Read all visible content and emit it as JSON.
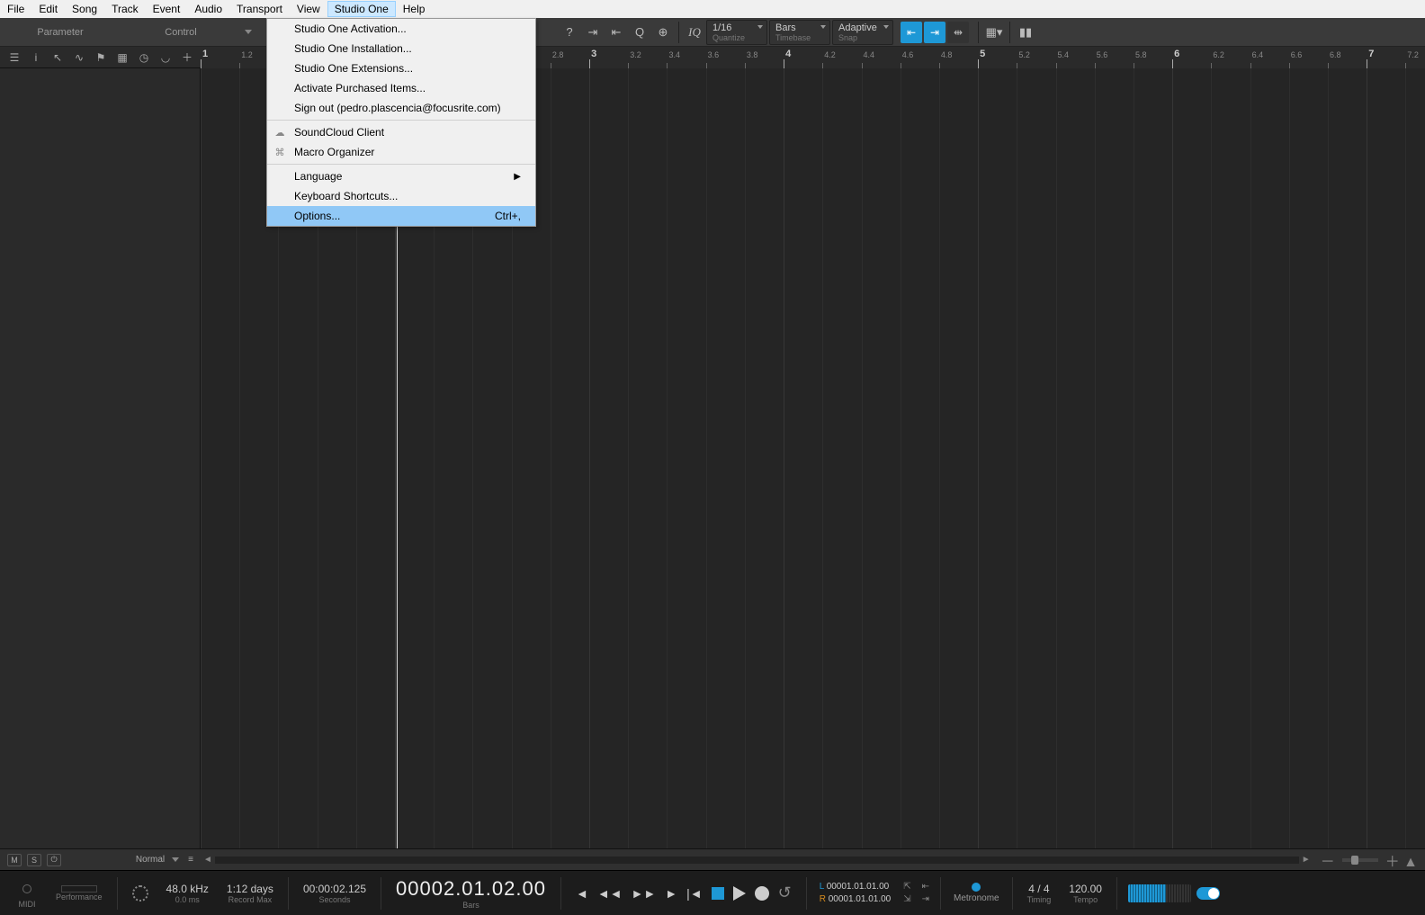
{
  "menubar": [
    "File",
    "Edit",
    "Song",
    "Track",
    "Event",
    "Audio",
    "Transport",
    "View",
    "Studio One",
    "Help"
  ],
  "menubar_active_index": 8,
  "dropdown": {
    "groups": [
      [
        {
          "label": "Studio One Activation..."
        },
        {
          "label": "Studio One Installation..."
        },
        {
          "label": "Studio One Extensions..."
        },
        {
          "label": "Activate Purchased Items..."
        },
        {
          "label": "Sign out (pedro.plascencia@focusrite.com)"
        }
      ],
      [
        {
          "label": "SoundCloud Client",
          "icon": "cloud"
        },
        {
          "label": "Macro Organizer",
          "icon": "macro"
        }
      ],
      [
        {
          "label": "Language",
          "submenu": true
        },
        {
          "label": "Keyboard Shortcuts..."
        },
        {
          "label": "Options...",
          "shortcut": "Ctrl+,",
          "highlight": true
        }
      ]
    ]
  },
  "parameter_label": "Parameter",
  "control_label": "Control",
  "iq_label": "IQ",
  "quantize": {
    "value": "1/16",
    "label": "Quantize"
  },
  "timebase": {
    "value": "Bars",
    "label": "Timebase"
  },
  "snap": {
    "value": "Adaptive",
    "label": "Snap"
  },
  "timesig": {
    "num": "4",
    "den": "4/4"
  },
  "ruler_start": 1,
  "ruler_end": 7.3,
  "playhead_bar": 2.01,
  "track_controls": {
    "m": "M",
    "s": "S",
    "mode": "Normal"
  },
  "transport": {
    "midi": "MIDI",
    "performance": "Performance",
    "sample_rate": "48.0 kHz",
    "latency": "0.0 ms",
    "rec_max": "1:12 days",
    "rec_max_label": "Record Max",
    "seconds": "00:00:02.125",
    "seconds_label": "Seconds",
    "bars": "00002.01.02.00",
    "bars_label": "Bars",
    "loc_l": "00001.01.01.00",
    "loc_r": "00001.01.01.00",
    "l_prefix": "L",
    "r_prefix": "R",
    "metronome": "Metronome",
    "timing_sig": "4 / 4",
    "timing_label": "Timing",
    "tempo": "120.00",
    "tempo_label": "Tempo"
  }
}
